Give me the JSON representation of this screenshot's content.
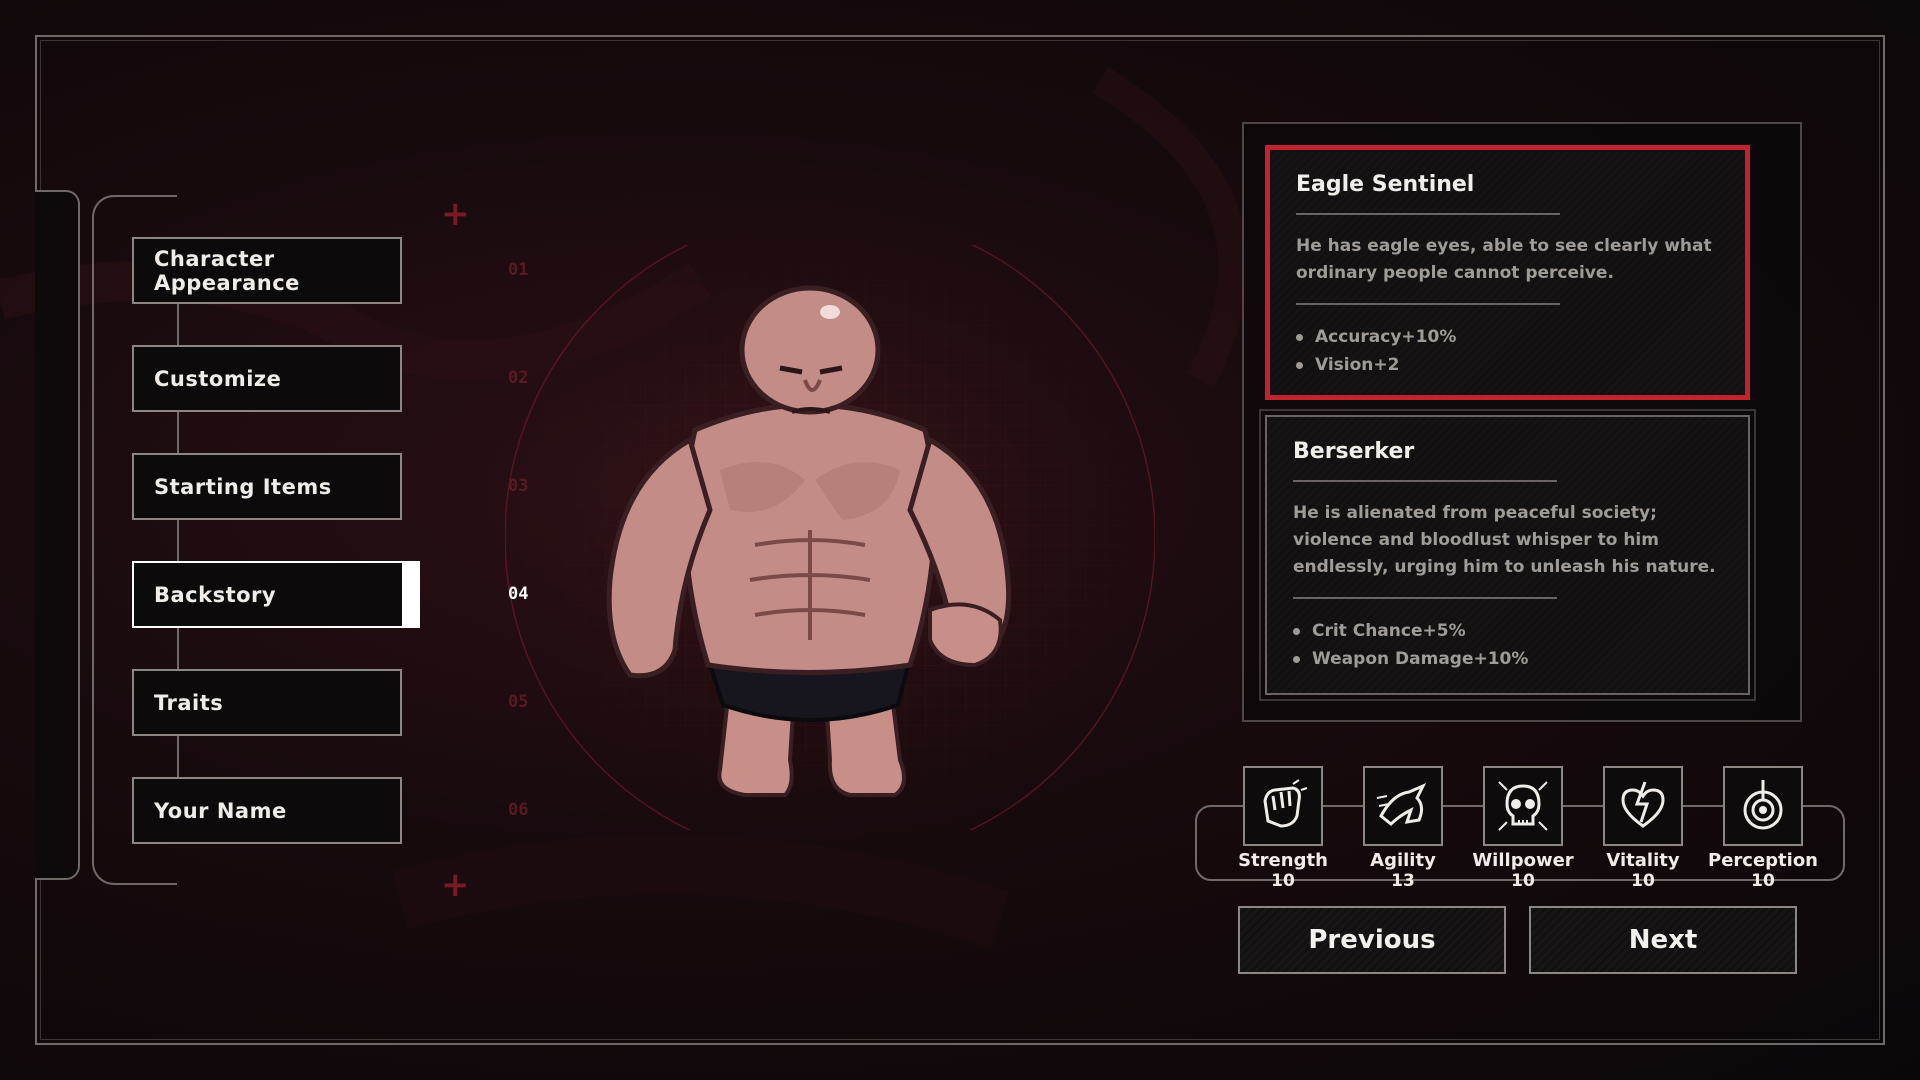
{
  "menu": {
    "items": [
      {
        "label": "Character Appearance",
        "active": false
      },
      {
        "label": "Customize",
        "active": false
      },
      {
        "label": "Starting Items",
        "active": false
      },
      {
        "label": "Backstory",
        "active": true
      },
      {
        "label": "Traits",
        "active": false
      },
      {
        "label": "Your Name",
        "active": false
      }
    ]
  },
  "steps": [
    "01",
    "02",
    "03",
    "04",
    "05",
    "06"
  ],
  "current_step": "04",
  "backstories": [
    {
      "title": "Eagle Sentinel",
      "description": "He has eagle eyes, able to see clearly what ordinary people cannot perceive.",
      "bonuses": [
        "Accuracy+10%",
        "Vision+2"
      ],
      "selected": true
    },
    {
      "title": "Berserker",
      "description": "He is alienated from peaceful society; violence and bloodlust whisper to him endlessly, urging him to unleash his nature.",
      "bonuses": [
        "Crit Chance+5%",
        "Weapon Damage+10%"
      ],
      "selected": false
    }
  ],
  "stats": [
    {
      "name": "Strength",
      "value": "10",
      "icon": "fist-icon"
    },
    {
      "name": "Agility",
      "value": "13",
      "icon": "running-beast-icon"
    },
    {
      "name": "Willpower",
      "value": "10",
      "icon": "skull-icon"
    },
    {
      "name": "Vitality",
      "value": "10",
      "icon": "heart-bolt-icon"
    },
    {
      "name": "Perception",
      "value": "10",
      "icon": "target-eye-icon"
    }
  ],
  "buttons": {
    "previous": "Previous",
    "next": "Next"
  },
  "colors": {
    "accent_red": "#c0242f",
    "panel_border": "#8c8785",
    "text_light": "#f1ece8",
    "text_muted": "#a19b98"
  }
}
